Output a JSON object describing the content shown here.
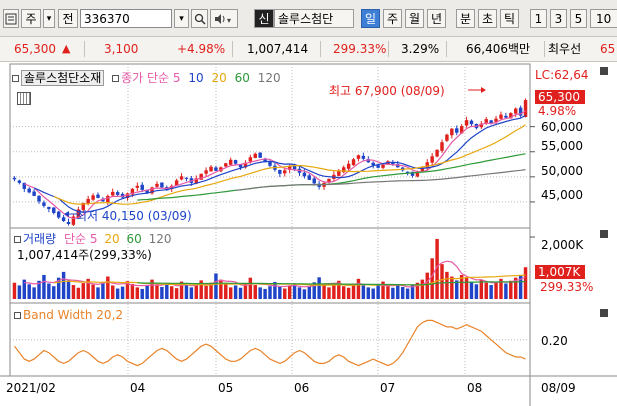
{
  "toolbar": {
    "type_select": "주",
    "type_dropdown": "▾",
    "field_label": "전",
    "code": "336370",
    "code_dropdown": "▾",
    "badge": "신",
    "stock_name": "솔루스첨단",
    "periods": [
      "일",
      "주",
      "월",
      "년",
      "분",
      "초",
      "틱"
    ],
    "selected_period": "일",
    "numbers": [
      "1",
      "3",
      "5",
      "10"
    ]
  },
  "quote": {
    "price": "65,300",
    "change_arrow": "▲",
    "change": "3,100",
    "change_pct": "+4.98%",
    "volume": "1,007,414",
    "volume_ratio": "299.33%",
    "turnover": "3.29%",
    "amount": "66,406백만",
    "last_label": "최우선",
    "last_value": "65"
  },
  "colors": {
    "up": "#e0201d",
    "down": "#1f44c8",
    "ma5": "#e65aa6",
    "ma10": "#1f44c8",
    "ma20": "#e6a80e",
    "ma60": "#2e9a38",
    "ma120": "#777777",
    "bandwidth": "#e8832a"
  },
  "price_panel": {
    "legend_name": "솔루스첨단소재",
    "legend_type": "종가 단순",
    "periods": [
      "5",
      "10",
      "20",
      "60",
      "120"
    ],
    "high_note": "최고 67,900 (08/09)",
    "low_note": "최저 40,150 (03/09)",
    "lc_label": "LC:62,64",
    "current_price": "65,300",
    "change_pct": "4.98%",
    "y_ticks": [
      "60,000",
      "55,000",
      "50,000",
      "45,000"
    ],
    "y_tick_values": [
      60000,
      55000,
      50000,
      45000
    ],
    "ylim": [
      41000,
      68500
    ]
  },
  "volume_panel": {
    "legend": "거래량",
    "legend_type": "단순",
    "periods": [
      "5",
      "20",
      "60",
      "120"
    ],
    "info": "1,007,414주(299,33%)",
    "y_tick": "2,000K",
    "current": "1,007K",
    "current_pct": "299.33%"
  },
  "bw_panel": {
    "legend": "Band Width 20,2",
    "y_tick": "0.20"
  },
  "x_axis": {
    "labels": [
      "2021/02",
      "04",
      "05",
      "06",
      "07",
      "08"
    ],
    "right_label": "08/09"
  },
  "chart_data": {
    "type": "candlestick",
    "title": "솔루스첨단소재",
    "x_range": [
      "2021/02",
      "08/09"
    ],
    "ylim": [
      40150,
      67900
    ],
    "high": {
      "value": 67900,
      "date": "08/09"
    },
    "low": {
      "value": 40150,
      "date": "03/09"
    },
    "close_series": [
      49500,
      48800,
      47600,
      46900,
      46200,
      45100,
      44200,
      43600,
      42800,
      41900,
      41200,
      40600,
      42100,
      43500,
      44800,
      45600,
      46300,
      45800,
      45100,
      46200,
      47000,
      46400,
      45900,
      46700,
      47600,
      48200,
      47400,
      46800,
      47900,
      48600,
      47900,
      47300,
      48200,
      49300,
      50100,
      49600,
      48800,
      49700,
      50600,
      51300,
      52000,
      51200,
      51900,
      52700,
      53400,
      52600,
      51900,
      52800,
      53900,
      54600,
      53800,
      52900,
      52200,
      51400,
      50600,
      51300,
      52100,
      51500,
      50800,
      50100,
      49400,
      48700,
      48000,
      48800,
      49600,
      50400,
      51100,
      51900,
      52600,
      53500,
      54300,
      53600,
      52900,
      52300,
      51800,
      52400,
      53100,
      52500,
      51900,
      51300,
      50800,
      50200,
      51000,
      51800,
      52900,
      54100,
      55400,
      56900,
      58400,
      59600,
      58800,
      60100,
      61300,
      60500,
      59700,
      60600,
      61500,
      60700,
      61600,
      62400,
      61800,
      62700,
      63600,
      62200,
      65300
    ],
    "volume_series": [
      0.42,
      0.35,
      0.5,
      0.38,
      0.3,
      0.47,
      0.62,
      0.4,
      0.33,
      0.55,
      0.7,
      0.48,
      0.36,
      0.29,
      0.41,
      0.52,
      0.37,
      0.3,
      0.44,
      0.58,
      0.35,
      0.27,
      0.32,
      0.46,
      0.39,
      0.3,
      0.26,
      0.34,
      0.5,
      0.38,
      0.31,
      0.4,
      0.33,
      0.28,
      0.45,
      0.37,
      0.3,
      0.36,
      0.48,
      0.34,
      0.42,
      0.66,
      0.5,
      0.39,
      0.3,
      0.35,
      0.29,
      0.41,
      0.55,
      0.36,
      0.3,
      0.26,
      0.33,
      0.44,
      0.31,
      0.27,
      0.35,
      0.4,
      0.3,
      0.25,
      0.32,
      0.43,
      0.56,
      0.38,
      0.3,
      0.36,
      0.47,
      0.33,
      0.29,
      0.4,
      0.52,
      0.35,
      0.3,
      0.27,
      0.38,
      0.45,
      0.33,
      0.29,
      0.36,
      0.31,
      0.27,
      0.35,
      0.42,
      0.5,
      0.68,
      1.05,
      1.55,
      0.9,
      0.7,
      0.58,
      0.48,
      0.62,
      0.55,
      0.44,
      0.38,
      0.5,
      0.42,
      0.36,
      0.45,
      0.52,
      0.4,
      0.47,
      0.55,
      0.6,
      0.82
    ],
    "volume_unit": "M shares",
    "bandwidth_series": [
      0.17,
      0.14,
      0.11,
      0.1,
      0.11,
      0.13,
      0.15,
      0.14,
      0.12,
      0.1,
      0.09,
      0.1,
      0.12,
      0.14,
      0.15,
      0.14,
      0.12,
      0.1,
      0.09,
      0.1,
      0.12,
      0.13,
      0.12,
      0.1,
      0.09,
      0.08,
      0.09,
      0.11,
      0.13,
      0.15,
      0.16,
      0.15,
      0.13,
      0.11,
      0.1,
      0.11,
      0.13,
      0.15,
      0.17,
      0.18,
      0.17,
      0.15,
      0.13,
      0.11,
      0.1,
      0.1,
      0.11,
      0.13,
      0.15,
      0.16,
      0.15,
      0.13,
      0.11,
      0.1,
      0.09,
      0.1,
      0.12,
      0.14,
      0.15,
      0.14,
      0.12,
      0.1,
      0.09,
      0.09,
      0.1,
      0.12,
      0.13,
      0.12,
      0.1,
      0.09,
      0.08,
      0.09,
      0.1,
      0.11,
      0.1,
      0.09,
      0.08,
      0.09,
      0.11,
      0.14,
      0.18,
      0.22,
      0.26,
      0.28,
      0.29,
      0.29,
      0.28,
      0.27,
      0.26,
      0.26,
      0.25,
      0.26,
      0.27,
      0.26,
      0.25,
      0.24,
      0.22,
      0.2,
      0.18,
      0.16,
      0.14,
      0.13,
      0.12,
      0.12,
      0.11
    ],
    "bandwidth_ylim": [
      0.05,
      0.32
    ]
  }
}
